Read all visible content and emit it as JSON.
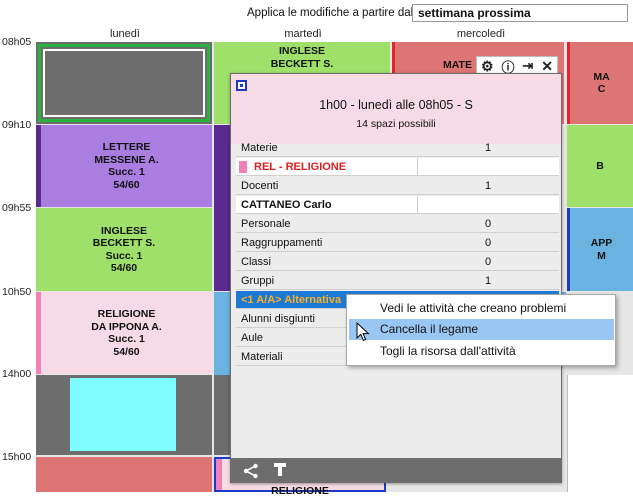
{
  "top_bar": {
    "apply_label": "Applica le modifiche a partire dalla",
    "apply_value": "settimana prossima"
  },
  "days": [
    "lunedì",
    "martedì",
    "mercoledì"
  ],
  "times": [
    "08h05",
    "09h10",
    "09h55",
    "10h50",
    "14h00",
    "15h00"
  ],
  "courses": {
    "mon2": {
      "line1": "LETTERE",
      "line2": "MESSENE A.",
      "line3": "Succ. 1",
      "line4": "54/60"
    },
    "mon3": {
      "line1": "INGLESE",
      "line2": "BECKETT S.",
      "line3": "Succ. 1",
      "line4": "54/60"
    },
    "mon4": {
      "line1": "RELIGIONE",
      "line2": "DA IPPONA A.",
      "line3": "Succ. 1",
      "line4": "54/60"
    },
    "tue1": {
      "line1": "INGLESE",
      "line2": "BECKETT S."
    },
    "tue_bottom": {
      "line1": "RELIGIONE"
    },
    "wed1": {
      "line1": "MATE"
    },
    "col4_1": {
      "line1": "MA",
      "line2": "C"
    },
    "col4_2": {
      "line1": "B"
    },
    "col4_3": {
      "line1": "APP",
      "line2": "M"
    }
  },
  "popup": {
    "title": "1h00  -  lunedì alle 08h05  -  S",
    "subtitle": "14 spazi possibili",
    "rows": {
      "materie": {
        "label": "Materie",
        "value": "1"
      },
      "rel": {
        "label": "REL - RELIGIONE"
      },
      "docenti": {
        "label": "Docenti",
        "value": "1"
      },
      "cattaneo": {
        "label": "CATTANEO Carlo"
      },
      "personale": {
        "label": "Personale",
        "value": "0"
      },
      "raggruppamenti": {
        "label": "Raggruppamenti",
        "value": "0"
      },
      "classi": {
        "label": "Classi",
        "value": "0"
      },
      "gruppi": {
        "label": "Gruppi",
        "value": "1"
      },
      "alternativa": {
        "label": "<1 A/A> Alternativa"
      },
      "alunni": {
        "label": "Alunni disgiunti"
      },
      "aule": {
        "label": "Aule"
      },
      "materiali": {
        "label": "Materiali"
      }
    }
  },
  "context_menu": {
    "items": [
      "Vedi le attività che creano problemi",
      "Cancella il legame",
      "Togli la risorsa dall'attività"
    ]
  },
  "colors": {
    "purple": "#a97ee0",
    "green": "#9ee06a",
    "pink": "#f6dbe6",
    "red": "#dd7575",
    "blue": "#6ab3e0",
    "highlight": "#99c6f3",
    "cyan": "#7dfdff"
  }
}
